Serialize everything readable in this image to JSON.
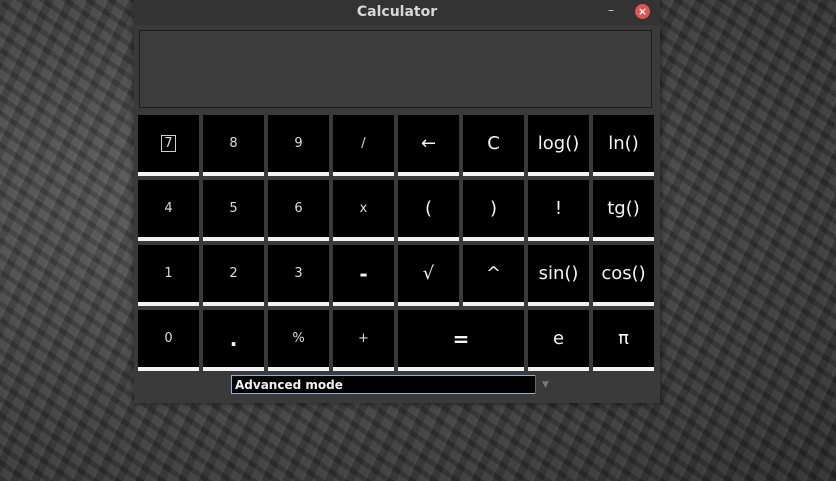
{
  "window": {
    "title": "Calculator",
    "minimize_label": "–",
    "close_label": "×"
  },
  "display": {
    "value": ""
  },
  "keys": [
    {
      "label": "7",
      "name": "key-7"
    },
    {
      "label": "8",
      "name": "key-8"
    },
    {
      "label": "9",
      "name": "key-9"
    },
    {
      "label": "/",
      "name": "key-divide"
    },
    {
      "label": "←",
      "name": "key-backspace"
    },
    {
      "label": "C",
      "name": "key-clear"
    },
    {
      "label": "log()",
      "name": "key-log"
    },
    {
      "label": "ln()",
      "name": "key-ln"
    },
    {
      "label": "4",
      "name": "key-4"
    },
    {
      "label": "5",
      "name": "key-5"
    },
    {
      "label": "6",
      "name": "key-6"
    },
    {
      "label": "x",
      "name": "key-multiply"
    },
    {
      "label": "(",
      "name": "key-open-paren"
    },
    {
      "label": ")",
      "name": "key-close-paren"
    },
    {
      "label": "!",
      "name": "key-factorial"
    },
    {
      "label": "tg()",
      "name": "key-tg"
    },
    {
      "label": "1",
      "name": "key-1"
    },
    {
      "label": "2",
      "name": "key-2"
    },
    {
      "label": "3",
      "name": "key-3"
    },
    {
      "label": "-",
      "name": "key-minus"
    },
    {
      "label": "√",
      "name": "key-sqrt"
    },
    {
      "label": "^",
      "name": "key-power"
    },
    {
      "label": "sin()",
      "name": "key-sin"
    },
    {
      "label": "cos()",
      "name": "key-cos"
    },
    {
      "label": "0",
      "name": "key-0"
    },
    {
      "label": ".",
      "name": "key-decimal"
    },
    {
      "label": "%",
      "name": "key-percent"
    },
    {
      "label": "+",
      "name": "key-plus"
    },
    {
      "label": "=",
      "name": "key-equals"
    },
    {
      "label": "e",
      "name": "key-e"
    },
    {
      "label": "π",
      "name": "key-pi"
    }
  ],
  "mode_select": {
    "selected": "Advanced mode",
    "arrow_icon": "chevron-down-icon"
  }
}
